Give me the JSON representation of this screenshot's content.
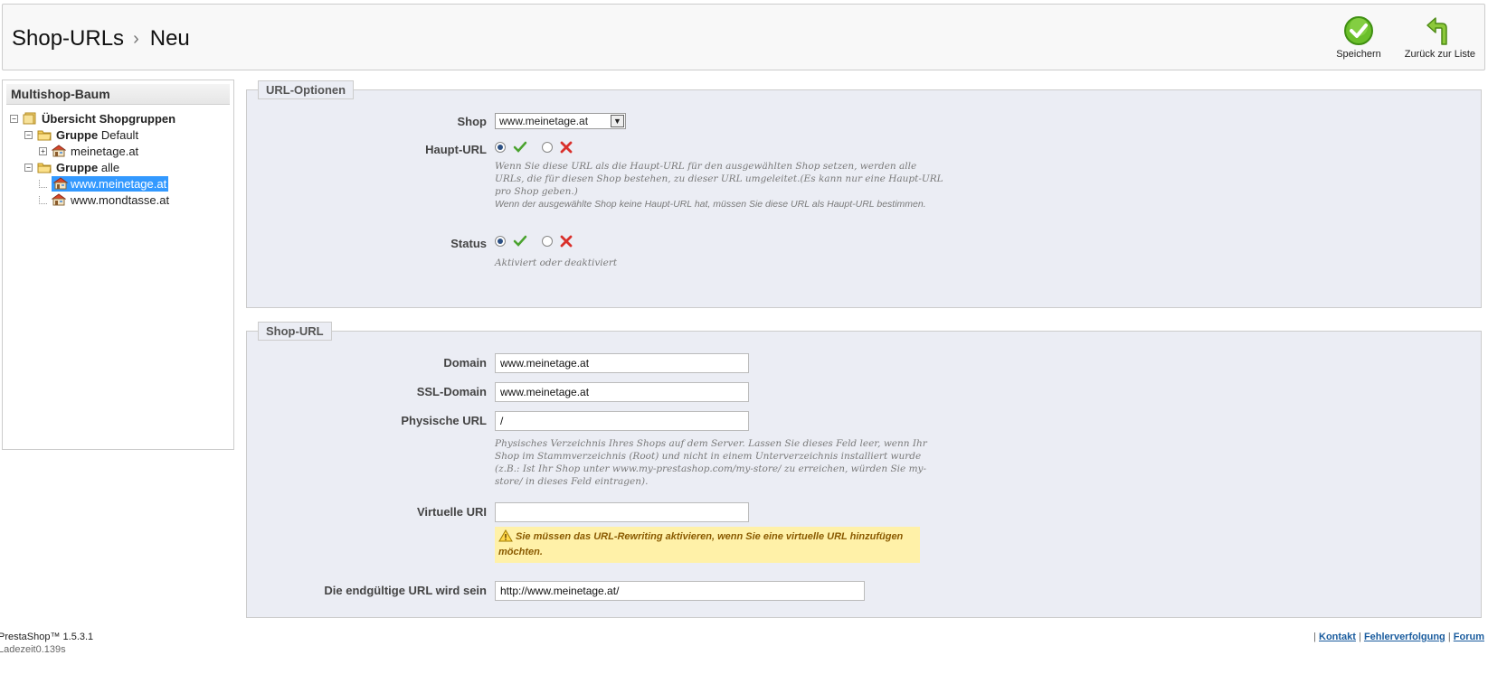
{
  "header": {
    "breadcrumb_root": "Shop-URLs",
    "breadcrumb_sep": "›",
    "breadcrumb_current": "Neu",
    "save_label": "Speichern",
    "back_label": "Zurück zur Liste"
  },
  "tree": {
    "title": "Multishop-Baum",
    "items": [
      {
        "prefix": "Übersicht Shopgruppen",
        "suffix": "",
        "level": 0,
        "icon": "shopgroups-icon"
      },
      {
        "prefix": "Gruppe",
        "suffix": "Default",
        "level": 1,
        "icon": "folder-icon"
      },
      {
        "prefix": "",
        "suffix": "meinetage.at",
        "level": 2,
        "icon": "shop-icon"
      },
      {
        "prefix": "Gruppe",
        "suffix": "alle",
        "level": 1,
        "icon": "folder-icon"
      },
      {
        "prefix": "",
        "suffix": "www.meinetage.at",
        "level": 2,
        "icon": "shop-icon",
        "selected": true
      },
      {
        "prefix": "",
        "suffix": "www.mondtasse.at",
        "level": 2,
        "icon": "shop-icon"
      }
    ]
  },
  "url_options": {
    "legend": "URL-Optionen",
    "shop_label": "Shop",
    "shop_value": "www.meinetage.at",
    "main_url_label": "Haupt-URL",
    "main_url_hint_1": "Wenn Sie diese URL als die Haupt-URL für den ausgewählten Shop setzen, werden alle URLs, die für diesen Shop bestehen, zu dieser URL umgeleitet.(Es kann nur eine Haupt-URL pro Shop geben.)",
    "main_url_hint_2": "Wenn der ausgewählte Shop keine Haupt-URL hat, müssen Sie diese URL als Haupt-URL bestimmen.",
    "status_label": "Status",
    "status_hint": "Aktiviert oder deaktiviert"
  },
  "shop_url": {
    "legend": "Shop-URL",
    "domain_label": "Domain",
    "domain_value": "www.meinetage.at",
    "ssl_label": "SSL-Domain",
    "ssl_value": "www.meinetage.at",
    "physical_label": "Physische URL",
    "physical_value": "/",
    "physical_hint": "Physisches Verzeichnis Ihres Shops auf dem Server. Lassen Sie dieses Feld leer, wenn Ihr Shop im Stammverzeichnis (Root) und nicht in einem Unterverzeichnis installiert wurde (z.B.: Ist Ihr Shop unter www.my-prestashop.com/my-store/ zu erreichen, würden Sie my-store/ in dieses Feld eintragen).",
    "virtual_label": "Virtuelle URI",
    "virtual_value": "",
    "virtual_warning": "Sie müssen das URL-Rewriting aktivieren, wenn Sie eine virtuelle URL hinzufügen möchten.",
    "final_label": "Die endgültige URL wird sein",
    "final_value": "http://www.meinetage.at/"
  },
  "footer": {
    "version": "PrestaShop™ 1.5.3.1",
    "load_time": "Ladezeit0.139s",
    "separator": "|",
    "contact": "Kontakt",
    "bugtracker": "Fehlerverfolgung",
    "forum": "Forum"
  },
  "colors": {
    "panel_bg": "#ebedf4",
    "selected_bg": "#3399ff",
    "link": "#1a5c9e",
    "warning_bg": "#fff1a8",
    "check_green": "#4aa32e",
    "cross_red": "#d9302b"
  }
}
